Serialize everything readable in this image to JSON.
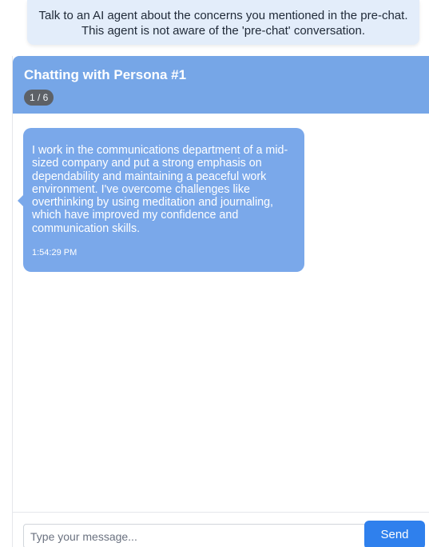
{
  "notice": {
    "line1": "Talk to an AI agent about the concerns you mentioned in the pre-chat.",
    "line2": "This agent is not aware of the 'pre-chat' conversation."
  },
  "chat": {
    "title": "Chatting with Persona #1",
    "counter": "1 / 6",
    "header_color": "#76a6e7",
    "messages": [
      {
        "text": "I work in the communications department of a mid-sized company and put a strong emphasis on dependability and maintaining a peaceful work environment. I've overcome challenges like overthinking by using meditation and journaling, which have improved my confidence and communication skills.",
        "time": "1:54:29 PM",
        "bubble_color": "#7aa8ea"
      }
    ]
  },
  "composer": {
    "placeholder": "Type your message...",
    "value": "",
    "send_label": "Send",
    "send_color": "#2f80ed"
  }
}
